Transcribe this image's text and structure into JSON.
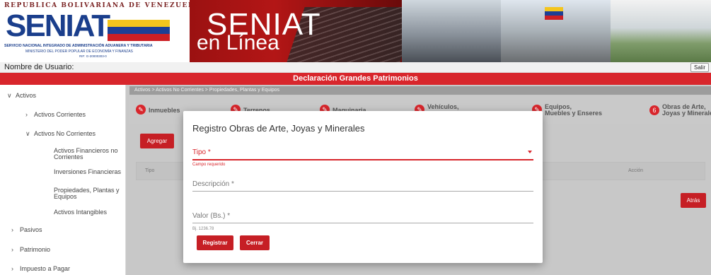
{
  "header": {
    "republic_text": "REPUBLICA BOLIVARIANA DE VENEZUELA",
    "logo_text": "SENIAT",
    "logo_subtitle_1": "SERVICIO NACIONAL INTEGRADO DE ADMINISTRACIÓN ADUANERA Y TRIBUTARIA",
    "logo_subtitle_2": "MINISTERIO DEL PODER POPULAR DE ECONOMÍA Y FINANZAS",
    "logo_subtitle_3": "RIF: G-20000303-0",
    "online_title_1": "SENIAT",
    "online_title_2": "en Línea"
  },
  "userbar": {
    "user_label": "Nombre de Usuario:",
    "logout_label": "Salir"
  },
  "title": "Declaración Grandes Patrimonios",
  "sidebar": {
    "items": [
      {
        "label": "Activos",
        "chevron": "v"
      },
      {
        "label": "Activos Corrientes",
        "chevron": ">"
      },
      {
        "label": "Activos No Corrientes",
        "chevron": "v"
      },
      {
        "label": "Activos Financieros no Corrientes"
      },
      {
        "label": "Inversiones Financieras"
      },
      {
        "label": "Propiedades, Plantas y Equipos"
      },
      {
        "label": "Activos Intangibles"
      },
      {
        "label": "Pasivos",
        "chevron": ">"
      },
      {
        "label": "Patrimonio",
        "chevron": ">"
      },
      {
        "label": "Impuesto a Pagar",
        "chevron": ">"
      }
    ]
  },
  "breadcrumb": "Activos > Activos No Corrientes > Propiedades, Plantas y Equipos",
  "steps": [
    {
      "label": "Inmuebles",
      "icon": "edit-icon"
    },
    {
      "label": "Terrenos",
      "icon": "edit-icon"
    },
    {
      "label": "Maquinaria",
      "icon": "edit-icon"
    },
    {
      "label": "Vehículos,",
      "icon": "edit-icon"
    },
    {
      "label_1": "Equipos,",
      "label_2": "Muebles y Enseres",
      "icon": "edit-icon"
    },
    {
      "label_1": "Obras de Arte,",
      "label_2": "Joyas y Minerales",
      "number": "6"
    }
  ],
  "buttons": {
    "agregar": "Agregar",
    "atras": "Atrás"
  },
  "table": {
    "columns": [
      "Tipo",
      "Acción"
    ]
  },
  "modal": {
    "title": "Registro Obras de Arte, Joyas y Minerales",
    "tipo_label": "Tipo *",
    "tipo_error": "Campo requerido",
    "descripcion_label": "Descripción *",
    "valor_label": "Valor (Bs.) *",
    "valor_hint": "Bj. 1236.78",
    "register_button": "Registrar",
    "close_button": "Cerrar"
  },
  "colors": {
    "accent": "#d8262c",
    "button": "#c61f25"
  }
}
